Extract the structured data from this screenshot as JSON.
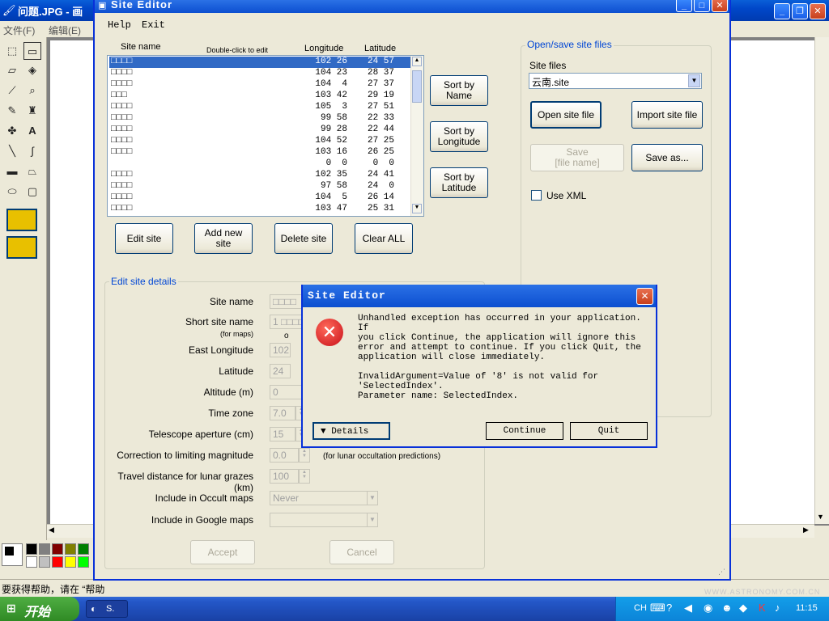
{
  "paint": {
    "title": "问题.JPG - 画",
    "menu": [
      "文件(F)",
      "编辑(E)"
    ],
    "status": "要获得帮助，请在 “帮助",
    "window_controls": [
      "minimize-icon",
      "restore-icon",
      "close-icon"
    ]
  },
  "site_editor": {
    "title": "Site  Editor",
    "menu": {
      "help": "Help",
      "exit": "Exit"
    },
    "list_headers": {
      "site_name": "Site name",
      "hint": "Double-click to edit",
      "longitude": "Longitude",
      "latitude": "Latitude"
    },
    "sites": [
      {
        "name": "□□□□",
        "lon": "102 26",
        "lat": "24 57",
        "selected": true
      },
      {
        "name": "□□□□",
        "lon": "104 23",
        "lat": "28 37"
      },
      {
        "name": "□□□□",
        "lon": "104  4",
        "lat": "27 37"
      },
      {
        "name": "□□□",
        "lon": "103 42",
        "lat": "29 19"
      },
      {
        "name": "□□□□",
        "lon": "105  3",
        "lat": "27 51"
      },
      {
        "name": "□□□□",
        "lon": "99 58",
        "lat": "22 33"
      },
      {
        "name": "□□□□",
        "lon": "99 28",
        "lat": "22 44"
      },
      {
        "name": "□□□□",
        "lon": "104 52",
        "lat": "27 25"
      },
      {
        "name": "□□□□",
        "lon": "103 16",
        "lat": "26 25"
      },
      {
        "name": "",
        "lon": "0  0",
        "lat": "0  0"
      },
      {
        "name": "□□□□",
        "lon": "102 35",
        "lat": "24 41"
      },
      {
        "name": "□□□□",
        "lon": "97 58",
        "lat": "24  0"
      },
      {
        "name": "□□□□",
        "lon": "104  5",
        "lat": "26 14"
      },
      {
        "name": "□□□□",
        "lon": "103 47",
        "lat": "25 31"
      }
    ],
    "sort_buttons": [
      "Sort by\nName",
      "Sort by\nLongitude",
      "Sort by\nLatitude"
    ],
    "list_buttons": {
      "edit": "Edit site",
      "add": "Add new\nsite",
      "delete": "Delete site",
      "clear": "Clear ALL"
    },
    "file_group": {
      "label": "Open/save site files",
      "files_label": "Site files",
      "selected_file": "云南.site",
      "open": "Open site file",
      "import": "Import site file",
      "save": "Save\n[file name]",
      "save_as": "Save as...",
      "use_xml": "Use XML"
    },
    "details": {
      "label": "Edit site details",
      "fields": [
        {
          "label": "Site name",
          "value": "□□□□"
        },
        {
          "label": "Short site name",
          "sub": "(for maps)",
          "value": "1  □□□□"
        },
        {
          "label": "East Longitude",
          "value": "102"
        },
        {
          "label": "Latitude",
          "value": "24"
        },
        {
          "label": "Altitude (m)",
          "value": "0"
        },
        {
          "label": "Time zone",
          "value": "7.0"
        },
        {
          "label": "Telescope aperture (cm)",
          "value": "15"
        },
        {
          "label": "Correction to limiting magnitude",
          "value": "0.0"
        },
        {
          "label": "Travel distance for lunar grazes (km)",
          "value": "100"
        },
        {
          "label": "Include in Occult maps",
          "value": "Never"
        },
        {
          "label": "Include in Google maps",
          "value": ""
        }
      ],
      "o_marker": "o",
      "lunar_note": "(for lunar occultation predictions)",
      "accept": "Accept",
      "cancel": "Cancel"
    }
  },
  "dialog": {
    "title": "Site  Editor",
    "message": "Unhandled exception has occurred in your application. If\nyou click Continue, the application will ignore this\nerror and attempt to continue. If you click Quit, the\napplication will close immediately.\n\nInvalidArgument=Value of '8' is not valid for\n'SelectedIndex'.\nParameter name: SelectedIndex.",
    "details": "Details",
    "continue": "Continue",
    "quit": "Quit"
  },
  "taskbar": {
    "start": "开始",
    "task": "S.",
    "lang": "CH",
    "clock": "11:15"
  },
  "watermark": "WWW.ASTRONOMY.COM.CN"
}
